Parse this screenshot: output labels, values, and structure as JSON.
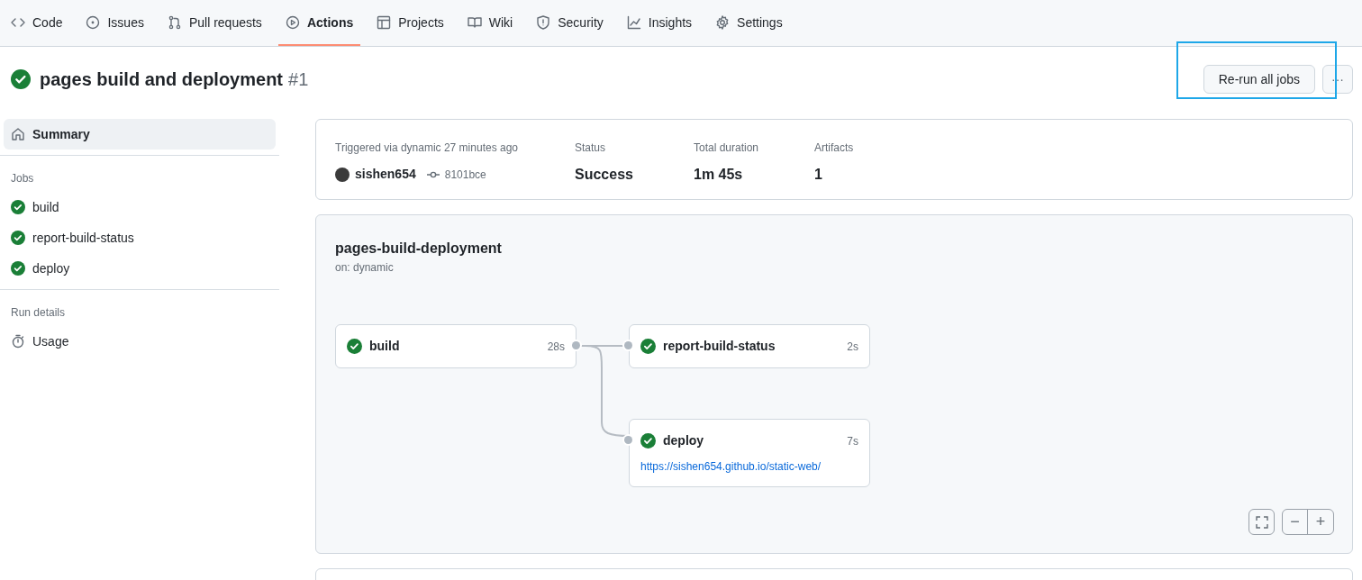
{
  "tabs": [
    {
      "label": "Code",
      "selected": false
    },
    {
      "label": "Issues",
      "selected": false
    },
    {
      "label": "Pull requests",
      "selected": false
    },
    {
      "label": "Actions",
      "selected": true
    },
    {
      "label": "Projects",
      "selected": false
    },
    {
      "label": "Wiki",
      "selected": false
    },
    {
      "label": "Security",
      "selected": false
    },
    {
      "label": "Insights",
      "selected": false
    },
    {
      "label": "Settings",
      "selected": false
    }
  ],
  "run": {
    "success": true,
    "title": "pages build and deployment",
    "number": "#1",
    "rerun_button": {
      "label": "Re-run all jobs",
      "highlighted": true
    },
    "more_button": "···"
  },
  "sidebar": {
    "summary": {
      "label": "Summary",
      "selected": true
    },
    "jobs_heading": "Jobs",
    "jobs": [
      {
        "name": "build",
        "success": true,
        "selected": false
      },
      {
        "name": "report-build-status",
        "success": true,
        "selected": false
      },
      {
        "name": "deploy",
        "success": true,
        "selected": false
      }
    ],
    "details_heading": "Run details",
    "usage": {
      "label": "Usage",
      "selected": false
    }
  },
  "summary": {
    "trigger_label": "Triggered via dynamic 27 minutes ago",
    "user": "sishen654",
    "commit": "8101bce",
    "stats": [
      {
        "label": "Status",
        "value": "Success"
      },
      {
        "label": "Total duration",
        "value": "1m 45s"
      },
      {
        "label": "Artifacts",
        "value": "1"
      }
    ]
  },
  "workflow": {
    "name": "pages-build-deployment",
    "trigger": "on: dynamic",
    "jobs": [
      {
        "name": "build",
        "duration": "28s",
        "success": true
      },
      {
        "name": "report-build-status",
        "duration": "2s",
        "success": true
      },
      {
        "name": "deploy",
        "duration": "7s",
        "success": true,
        "url": "https://sishen654.github.io/static-web/"
      }
    ],
    "zoom_controls": {
      "zoom_out": "−",
      "zoom_in": "+"
    }
  }
}
